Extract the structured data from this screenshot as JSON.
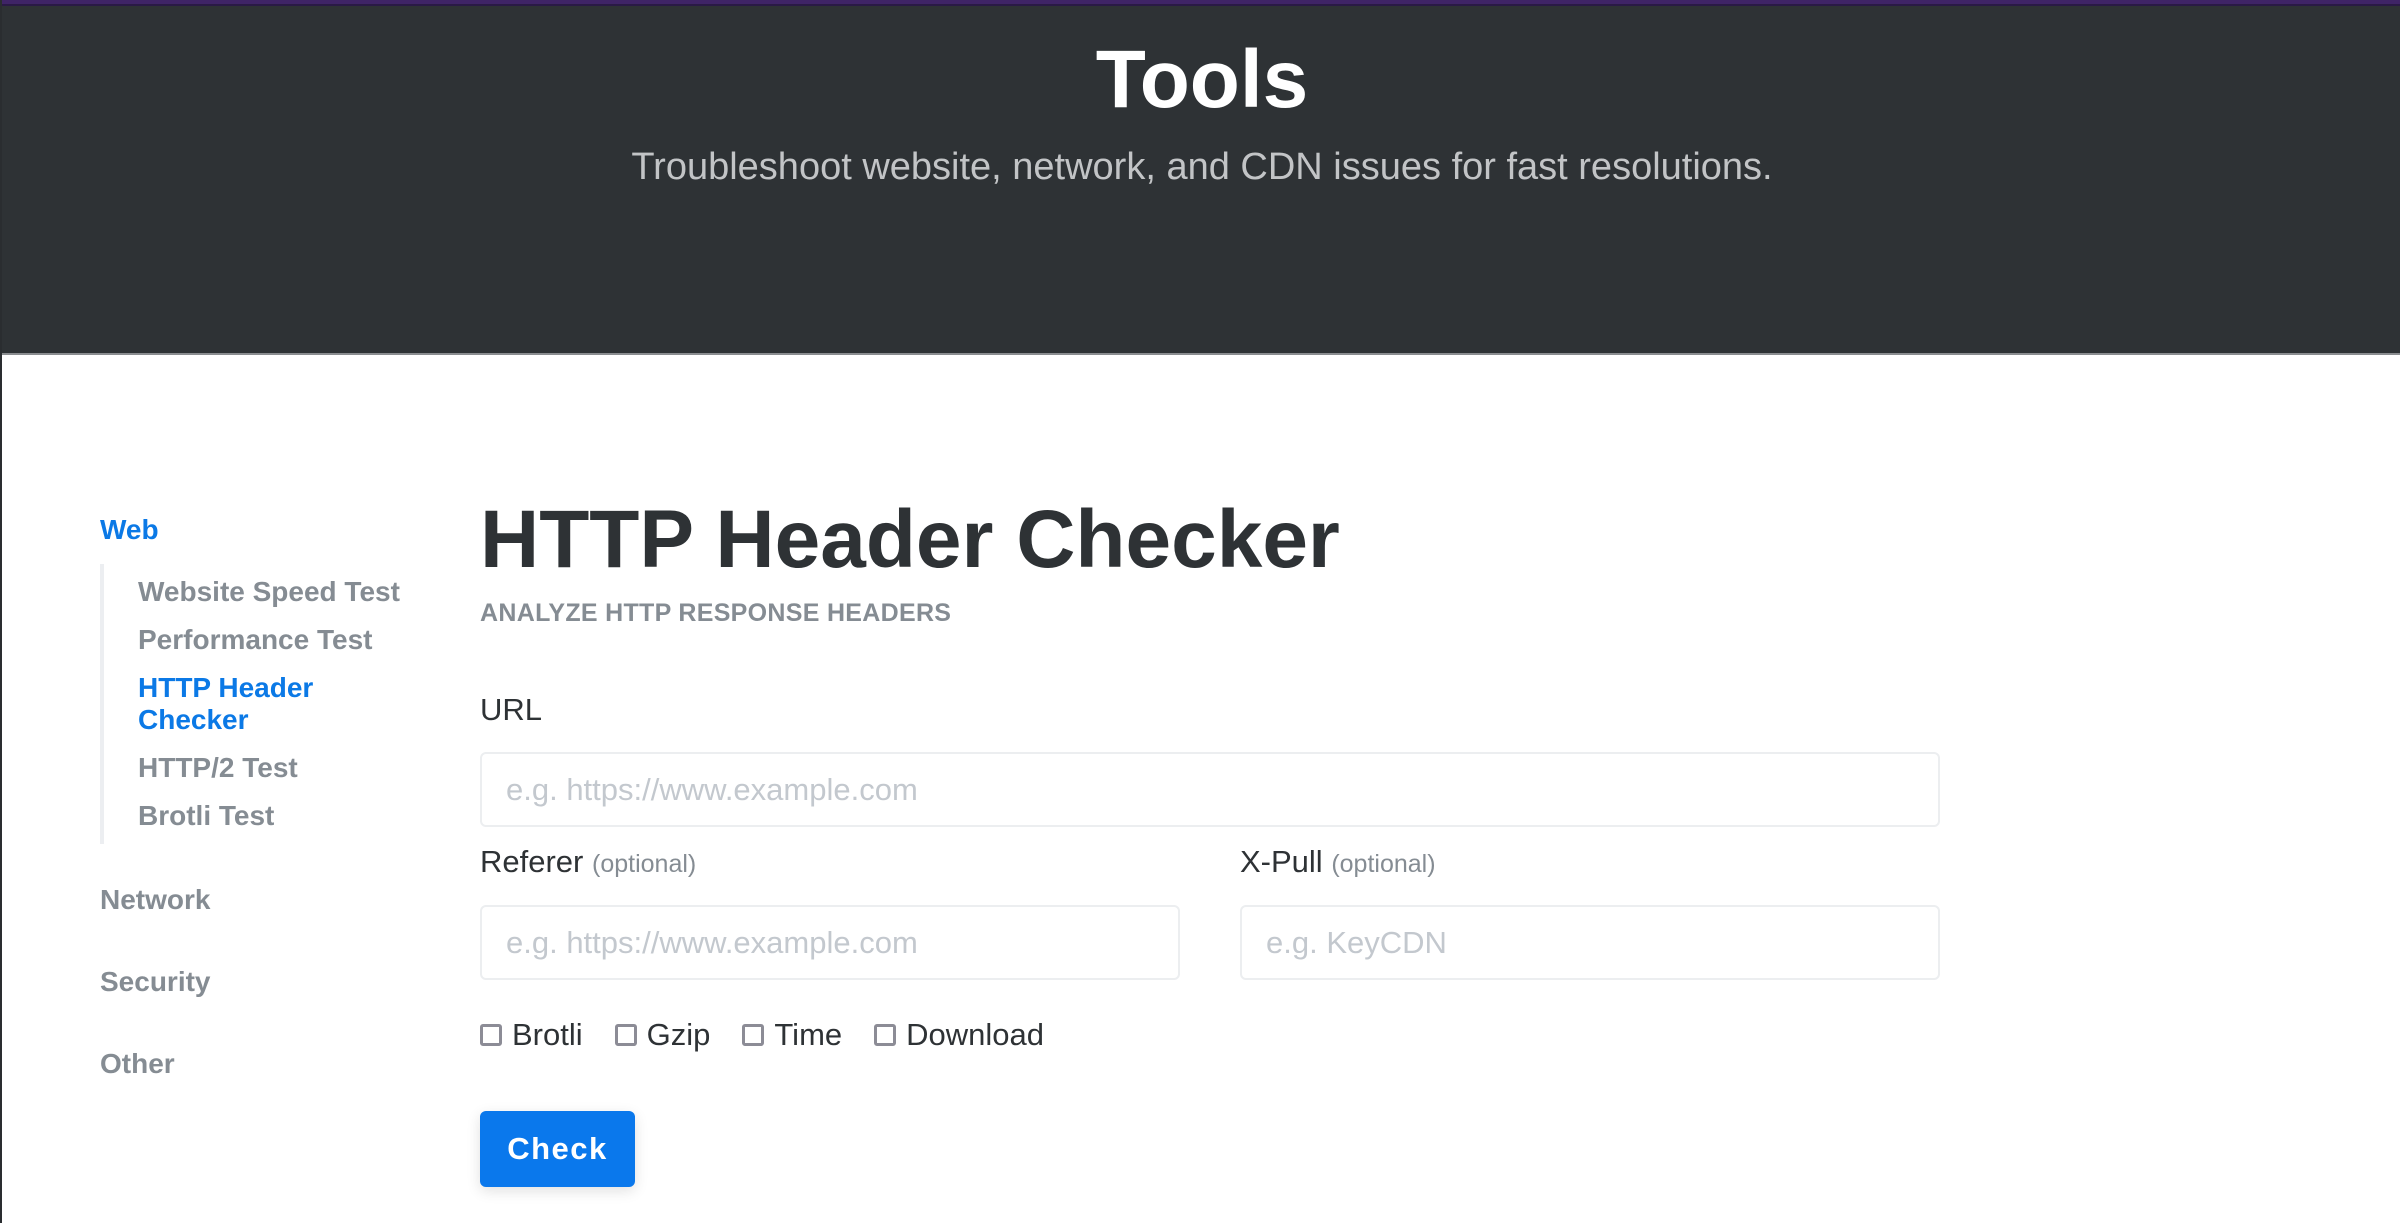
{
  "hero": {
    "title": "Tools",
    "subtitle": "Troubleshoot website, network, and CDN issues for fast resolutions."
  },
  "sidebar": {
    "groups": [
      {
        "label": "Web",
        "active": true,
        "items": [
          {
            "label": "Website Speed Test",
            "active": false
          },
          {
            "label": "Performance Test",
            "active": false
          },
          {
            "label": "HTTP Header Checker",
            "active": true
          },
          {
            "label": "HTTP/2 Test",
            "active": false
          },
          {
            "label": "Brotli Test",
            "active": false
          }
        ]
      },
      {
        "label": "Network",
        "active": false
      },
      {
        "label": "Security",
        "active": false
      },
      {
        "label": "Other",
        "active": false
      }
    ]
  },
  "main": {
    "title": "HTTP Header Checker",
    "eyebrow": "ANALYZE HTTP RESPONSE HEADERS",
    "url": {
      "label": "URL",
      "value": "",
      "placeholder": "e.g. https://www.example.com"
    },
    "referer": {
      "label": "Referer",
      "optional": "(optional)",
      "value": "",
      "placeholder": "e.g. https://www.example.com"
    },
    "xpull": {
      "label": "X-Pull",
      "optional": "(optional)",
      "value": "",
      "placeholder": "e.g. KeyCDN"
    },
    "options": [
      {
        "label": "Brotli",
        "checked": false
      },
      {
        "label": "Gzip",
        "checked": false
      },
      {
        "label": "Time",
        "checked": false
      },
      {
        "label": "Download",
        "checked": false
      }
    ],
    "submit_label": "Check"
  },
  "colors": {
    "accent": "#0a78ec",
    "hero_bg": "#2e3235",
    "top_stripe": "#3f2466",
    "muted_text": "#858c93"
  }
}
